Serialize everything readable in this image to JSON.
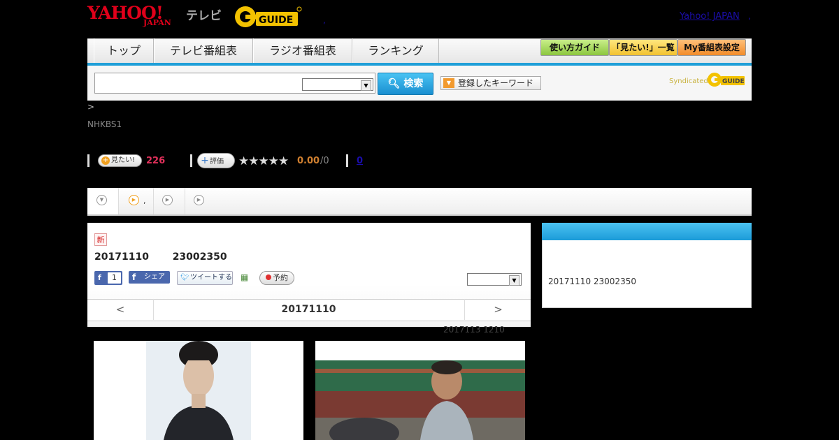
{
  "header": {
    "logo_yahoo": "YAHOO!",
    "logo_japan": "JAPAN",
    "logo_tv": "テレビ",
    "logo_gguide": "G GUIDE",
    "yahoo_japan_link": "Yahoo! JAPAN",
    "dot_small": ",",
    "dot_right": ","
  },
  "nav": {
    "tabs": [
      "トップ",
      "テレビ番組表",
      "ラジオ番組表",
      "ランキング"
    ],
    "guide_buttons": [
      "使い方ガイド",
      "「見たい!」一覧",
      "My番組表設定"
    ]
  },
  "search": {
    "button_label": "検索",
    "keyword_button": "登録したキーワード",
    "syndicated": "Syndicated"
  },
  "program": {
    "breadcrumb": ">",
    "channel": "NHKBS1",
    "mitai_label": "見たい!",
    "mitai_count": "226",
    "hyoka_label": "評価",
    "stars": "★★★★★",
    "score": "0.00",
    "score_count": "/0",
    "review_count": "0",
    "tab_dot": ",",
    "new_badge": "新",
    "date": "20171110",
    "time": "23002350",
    "fb_count": "1",
    "fb_share": "シェア",
    "tweet": "ツイートする",
    "yoyaku": "予約",
    "prev": "<",
    "next": ">",
    "datebar_date": "20171110",
    "rebroadcast": "2017113  1210"
  },
  "sidebar": {
    "text": "20171110  23002350"
  },
  "colors": {
    "accent_blue": "#1f9fd8",
    "brand_red": "#e0001a",
    "count_red": "#e0305a",
    "score_orange": "#d08030"
  }
}
